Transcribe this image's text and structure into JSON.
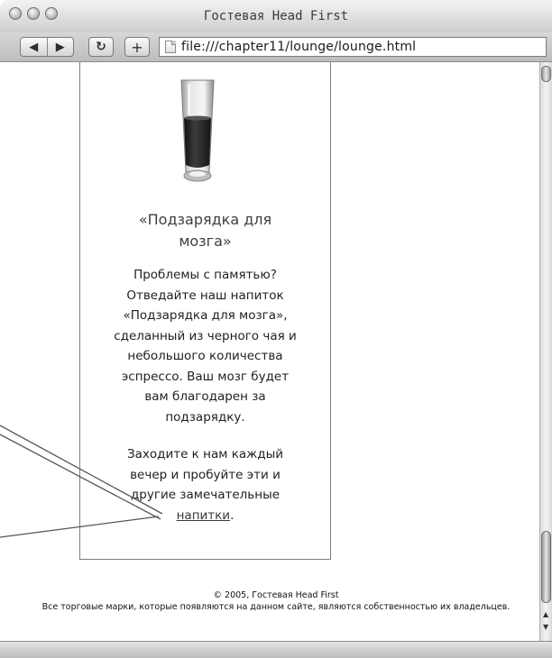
{
  "window": {
    "title": "Гостевая Head First"
  },
  "toolbar": {
    "url": "file:///chapter11/lounge/lounge.html"
  },
  "sidebar": {
    "elixir_title_line1": "«Подзарядка для",
    "elixir_title_line2": "мозга»",
    "desc_lines": [
      "Проблемы с памятью?",
      "Отведайте наш напиток",
      "«Подзарядка для мозга»,",
      "сделанный из черного чая и",
      "небольшого количества",
      "эспрессо. Ваш мозг будет",
      "вам благодарен за",
      "подзарядку."
    ],
    "invite_lines": [
      "Заходите к нам каждый",
      "вечер и пробуйте эти и",
      "другие замечательные"
    ],
    "link_text": "напитки",
    "link_suffix": "."
  },
  "footer": {
    "copyright": "© 2005, Гостевая Head First",
    "trademark": "Все торговые марки, которые появляются на данном сайте, являются собственностью их владельцев."
  },
  "colors": {
    "glass_liquid": "#2a2a2a",
    "frame_border": "#7d7d7d",
    "callout_line": "#555555"
  },
  "icons": [
    "back-arrow-icon",
    "forward-arrow-icon",
    "reload-icon",
    "add-icon",
    "page-icon",
    "scroll-up-icon",
    "scroll-down-icon"
  ]
}
